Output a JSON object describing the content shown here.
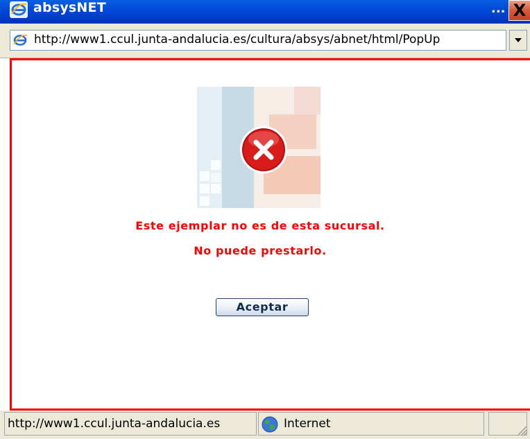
{
  "window": {
    "title": "absysNET",
    "more": "...",
    "close": "X"
  },
  "address": {
    "url": "http://www1.ccul.junta-andalucia.es/cultura/absys/abnet/html/PopUp"
  },
  "dialog": {
    "message_line1": "Este ejemplar no es de esta sucursal.",
    "message_line2": "No puede prestarlo.",
    "accept_label": "Aceptar",
    "message_color": "#ff0000",
    "icon": "error-icon"
  },
  "status": {
    "url": "http://www1.ccul.junta-andalucia.es",
    "zone": "Internet"
  }
}
